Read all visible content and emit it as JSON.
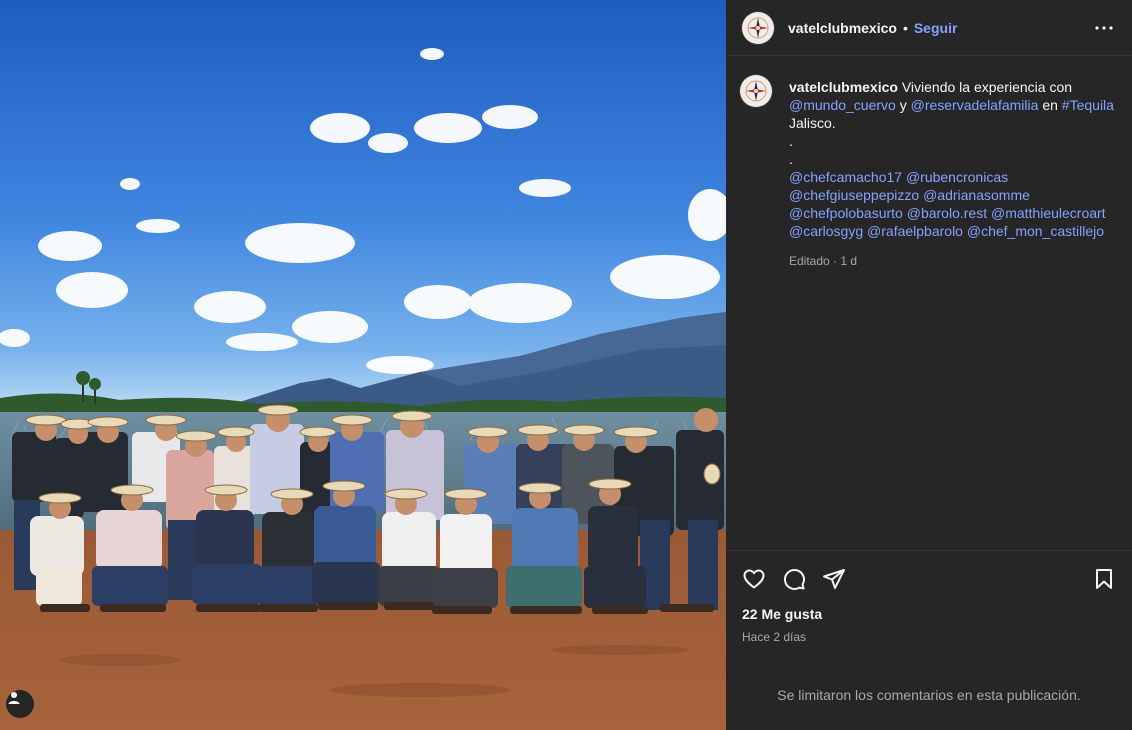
{
  "account": {
    "username": "vatelclubmexico",
    "separator": "•",
    "follow_label": "Seguir"
  },
  "caption": {
    "username": "vatelclubmexico",
    "text_1": " Viviendo la experiencia con ",
    "mention_1": "@mundo_cuervo",
    "text_2": " y ",
    "mention_2": "@reservadelafamilia",
    "text_3": " en ",
    "hashtag": "#Tequila",
    "text_4": " Jalisco.",
    "dot_1": ".",
    "dot_2": ".",
    "tags": [
      "@chefcamacho17",
      "@rubencronicas",
      "@chefgiuseppepizzo",
      "@adrianasomme",
      "@chefpolobasurto",
      "@barolo.rest",
      "@matthieulecroart",
      "@carlosgyg",
      "@rafaelpbarolo",
      "@chef_mon_castillejo"
    ],
    "meta": "Editado · 1 d"
  },
  "icons": {
    "avatar": "compass-logo-icon",
    "more": "more-horizontal-icon",
    "like": "heart-icon",
    "comment": "comment-icon",
    "share": "paper-plane-icon",
    "save": "bookmark-icon",
    "tag": "person-tag-icon"
  },
  "stats": {
    "likes": "22 Me gusta",
    "ago": "Hace 2 días"
  },
  "comments_notice": "Se limitaron los comentarios en esta publicación.",
  "colors": {
    "panel_bg": "#262626",
    "link": "#85a1ff",
    "muted": "#a8a8a8"
  }
}
